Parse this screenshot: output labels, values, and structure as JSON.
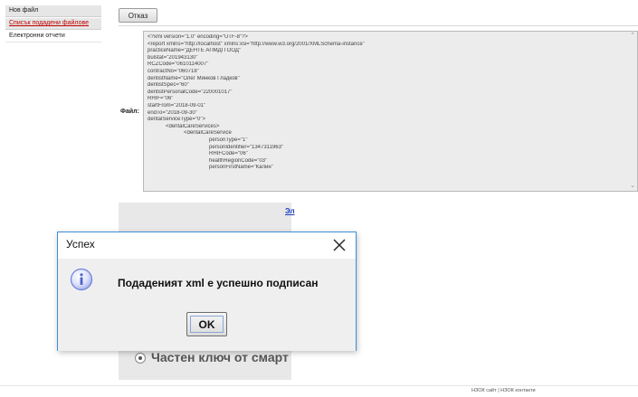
{
  "sidebar": {
    "items": [
      {
        "label": "Нов файл"
      },
      {
        "label": "Списък подадени файлове"
      },
      {
        "label": "Електронни отчети"
      }
    ]
  },
  "toolbar": {
    "cancel_label": "Отказ"
  },
  "file": {
    "label": "Файл:",
    "xml_lines": [
      "<?xml version=\"1.0\" encoding=\"UTF-8\"?>",
      "<report xmlns=\"http://localhost\" xmlns:xsi=\"http://www.w3.org/2001/XMLSchema-instance\"",
      "practiceName=\"ДЕНТЕ АПМДП ООД\"",
      "bulstat=\"201943130\"",
      "RCZCode=\"0610114007\"",
      "contractNo=\"060718\"",
      "dentistName=\"Олег Минков Гладков\"",
      "dentistSpec=\"60\"",
      "dentistPersonalCode=\"220001017\"",
      "RHIF=\"06\"",
      "startFrom=\"2018-09-01\"",
      "endTo=\"2018-09-30\"",
      "dentalServiceType=\"0\">",
      "<dentalCareServices>",
      "<dentalCareService",
      "personType=\"1\"",
      "personIdentifier=\"1347311963\"",
      "RHIFCode=\"06\"",
      "healthRegionCode=\"03\"",
      "personFirstName=\"Калин\""
    ]
  },
  "background_panel": {
    "link_text": "Эл",
    "smartcard_option": "Частен ключ от смарт к"
  },
  "footer": {
    "links": [
      "НЗОК сайт",
      "НЗОК контакти"
    ],
    "separator": "|"
  },
  "dialog": {
    "title": "Успех",
    "message": "Подаденият xml е успешно подписан",
    "ok_label": "OK",
    "icon": "info-icon",
    "close_icon": "close-icon"
  },
  "colors": {
    "sidebar_link": "#c00000",
    "dialog_border": "#3b8fd8",
    "info_icon": "#6b7fd8",
    "link_blue": "#1f3fbf"
  }
}
